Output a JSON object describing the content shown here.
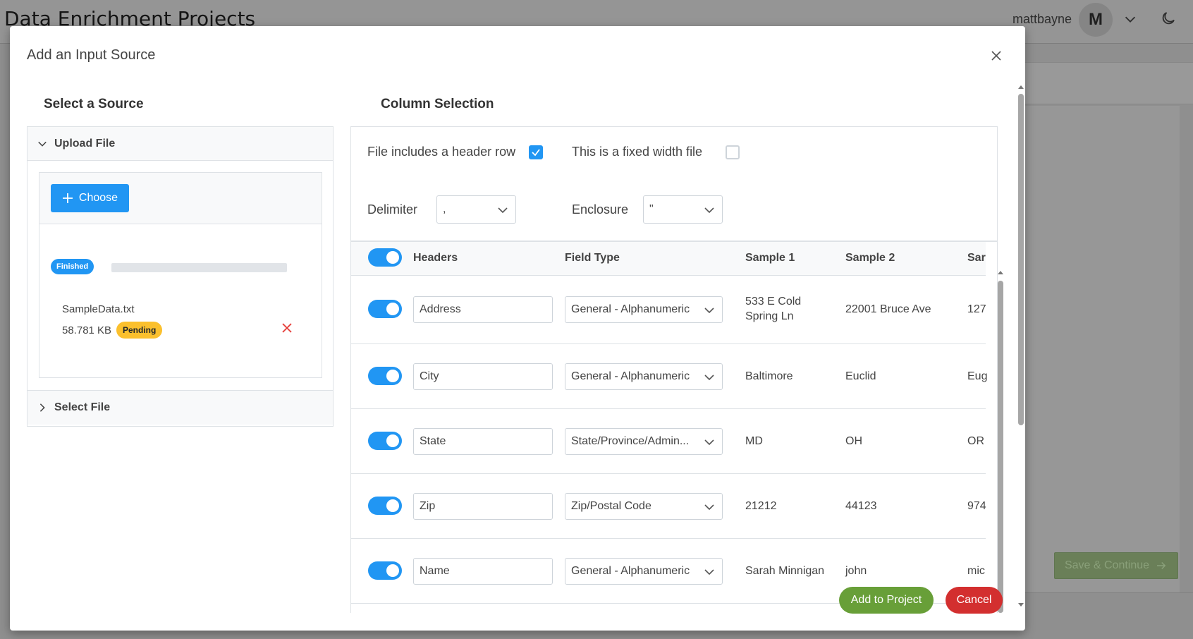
{
  "app": {
    "title": "Data Enrichment Projects",
    "user_name": "mattbayne",
    "avatar_initial": "M",
    "save_continue_label": "Save & Continue"
  },
  "modal": {
    "title": "Add an Input Source",
    "add_label": "Add to Project",
    "cancel_label": "Cancel"
  },
  "source": {
    "title": "Select a Source",
    "upload_label": "Upload File",
    "choose_label": "Choose",
    "finished_label": "Finished",
    "file_name": "SampleData.txt",
    "file_size": "58.781 KB",
    "status": "Pending",
    "select_file_label": "Select File"
  },
  "columns": {
    "title": "Column Selection",
    "header_row_label": "File includes a header row",
    "header_row_checked": true,
    "fixed_width_label": "This is a fixed width file",
    "fixed_width_checked": false,
    "delimiter_label": "Delimiter",
    "delimiter_value": ",",
    "enclosure_label": "Enclosure",
    "enclosure_value": "\"",
    "headers": {
      "col_headers": "Headers",
      "col_field_type": "Field Type",
      "col_sample1": "Sample 1",
      "col_sample2": "Sample 2",
      "col_sample3": "Sar"
    },
    "rows": [
      {
        "header": "Address",
        "field_type": "General - Alphanumeric",
        "sample1": "533 E Cold Spring Ln",
        "sample2": "22001 Bruce Ave",
        "sample3": "127"
      },
      {
        "header": "City",
        "field_type": "General - Alphanumeric",
        "sample1": "Baltimore",
        "sample2": "Euclid",
        "sample3": "Eug"
      },
      {
        "header": "State",
        "field_type": "State/Province/Admin...",
        "sample1": "MD",
        "sample2": "OH",
        "sample3": "OR"
      },
      {
        "header": "Zip",
        "field_type": "Zip/Postal Code",
        "sample1": "21212",
        "sample2": "44123",
        "sample3": "974"
      },
      {
        "header": "Name",
        "field_type": "General - Alphanumeric",
        "sample1": "Sarah Minnigan",
        "sample2": "john",
        "sample3": "mic"
      }
    ]
  },
  "colors": {
    "primary": "#2196f3",
    "success": "#689f38",
    "danger": "#d32f2f",
    "warning": "#fbc02d"
  },
  "icons": [
    "chevron-down-icon",
    "moon-icon",
    "close-icon",
    "plus-icon",
    "chevron-right-icon",
    "check-icon",
    "times-icon",
    "arrow-right-icon"
  ]
}
